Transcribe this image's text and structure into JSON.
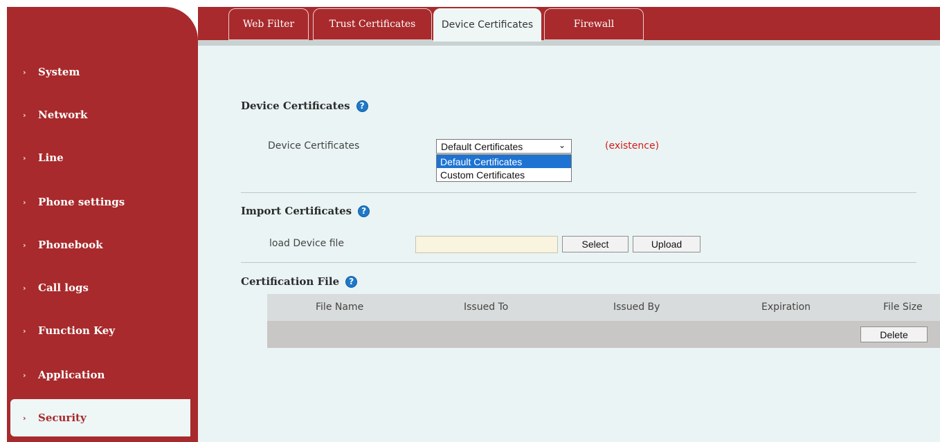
{
  "sidebar": {
    "items": [
      {
        "label": "System"
      },
      {
        "label": "Network"
      },
      {
        "label": "Line"
      },
      {
        "label": "Phone settings"
      },
      {
        "label": "Phonebook"
      },
      {
        "label": "Call logs"
      },
      {
        "label": "Function Key"
      },
      {
        "label": "Application"
      },
      {
        "label": "Security",
        "active": true
      }
    ],
    "chevron": "›"
  },
  "tabs": [
    {
      "label": "Web Filter"
    },
    {
      "label": "Trust Certificates"
    },
    {
      "label": "Device Certificates",
      "active": true
    },
    {
      "label": "Firewall"
    }
  ],
  "device_certificates": {
    "title": "Device Certificates",
    "field_label": "Device Certificates",
    "select_value": "Default Certificates",
    "options": [
      "Default Certificates",
      "Custom Certificates"
    ],
    "status": "(existence)"
  },
  "import": {
    "title": "Import Certificates",
    "field_label": "load Device file",
    "file_value": "",
    "select_button": "Select",
    "upload_button": "Upload"
  },
  "certification_file": {
    "title": "Certification File",
    "columns": [
      "File Name",
      "Issued To",
      "Issued By",
      "Expiration",
      "File Size"
    ],
    "delete_button": "Delete"
  },
  "icons": {
    "help": "?",
    "dropdown": "⌄"
  },
  "colors": {
    "brand_red": "#a82a2c",
    "content_bg": "#eaf4f4",
    "help_blue": "#1f78c8",
    "status_red": "#d11a1a",
    "selected_option": "#1e73d2"
  }
}
